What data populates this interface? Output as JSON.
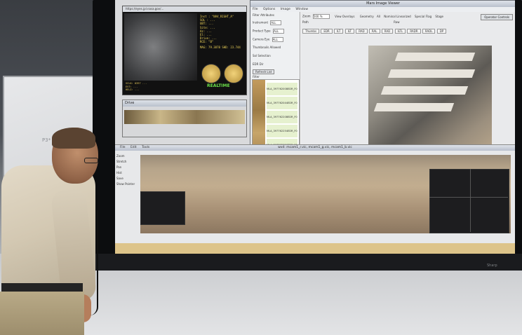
{
  "scene": {
    "whiteboard_scribble": "P3*"
  },
  "telemetry": {
    "url": "https://eyes.jpl.nasa.gov/...",
    "lines": [
      "Inst : \"NAV_RIGHT_A\"",
      "SOL : ...",
      "UBT: ...",
      "Site: ...",
      "Az: ...",
      "El: ...",
      "Drive: ...",
      "RCE: \"B\""
    ],
    "stats_left": "MAG: 79.3878",
    "stats_right": "SHD: 23.744",
    "realtime": "REALTIME",
    "footer": [
      "SCLK: 0397 ...",
      "EVT: ...",
      "HELI: ..."
    ]
  },
  "strip_window": {
    "title": "Drive"
  },
  "viewer": {
    "title": "Mars Image Viewer",
    "menu": [
      "File",
      "Options",
      "Image",
      "Window"
    ],
    "filter_header": "Filter Attributes",
    "filter_rows": [
      {
        "label": "Instrument",
        "value": "ALL"
      },
      {
        "label": "Product Type",
        "value": "ALL"
      },
      {
        "label": "Camera Eye",
        "value": "ALL"
      },
      {
        "label": "Thumbnails Allowed",
        "value": ""
      },
      {
        "label": "Sol Selection",
        "value": ""
      },
      {
        "label": "EDR Dir",
        "value": ""
      }
    ],
    "refresh_label": "Refresh List",
    "filter_label": "Filter",
    "list_items": [
      "MLA_397762008EDR_F00...",
      "MLA_397762044EDR_F00...",
      "MLA_397762208EDR_F00...",
      "MLA_397762254EDR_F00...",
      "MLA_397762526EDR_F00..."
    ],
    "zoom_label": "Zoom",
    "zoom_value": "500 %",
    "view_overlays": "View Overlays",
    "geometry_label": "Geometry",
    "geometry_options": [
      "All",
      "Raw"
    ],
    "nominal_linearized": "Nominal Linearized",
    "special_flag": "Special Flag",
    "stage_label": "Stage",
    "stage_value": "ALL",
    "operator_controls": "Operator Controls",
    "help": "Help",
    "path_label": "Path",
    "tabs": [
      "Thumbs",
      "EDR",
      "ILT",
      "ILT",
      "RAD",
      "RAL",
      "RAD",
      "ILTL",
      "RADR",
      "RADL",
      "DP"
    ]
  },
  "pano": {
    "title": "wvd: mcam1_r.vic, mcam1_g.vic, mcam1_b.vic",
    "menu": [
      "File",
      "Edit",
      "Tools"
    ],
    "side_labels": [
      "Zoom",
      "Stretch",
      "Pan",
      "Hist",
      "Save",
      "Show Pointer"
    ]
  },
  "monitor": {
    "brand": "Sharp"
  }
}
